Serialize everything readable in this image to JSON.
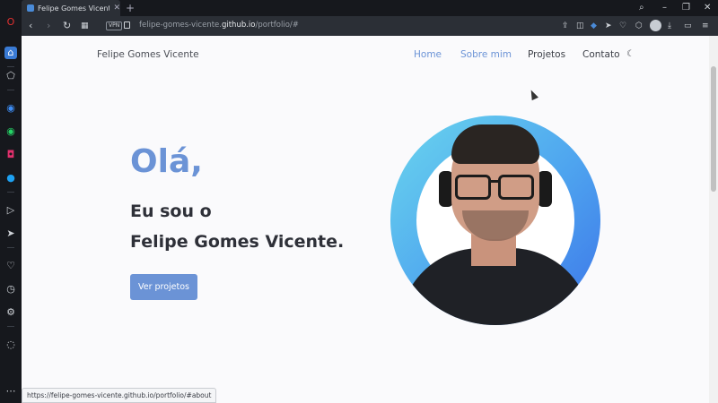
{
  "browser": {
    "tab_title": "Felipe Gomes Vicente - Portfolio",
    "tab_close": "✕",
    "new_tab": "+",
    "vpn_label": "VPN",
    "url_prefix": "felipe-gomes-vicente.",
    "url_host": "github.io",
    "url_path": "/portfolio/#",
    "status_url": "https://felipe-gomes-vicente.github.io/portfolio/#about"
  },
  "site": {
    "brand": "Felipe Gomes Vicente",
    "nav": {
      "home": "Home",
      "about": "Sobre mim",
      "projects": "Projetos",
      "contact": "Contato"
    },
    "hero": {
      "greeting": "Olá,",
      "line1": "Eu sou o",
      "line2": "Felipe Gomes Vicente.",
      "cta": "Ver projetos"
    }
  },
  "colors": {
    "accent": "#6b93d6",
    "ring_start": "#6ad6ee",
    "ring_end": "#3c74e8",
    "text_dark": "#2e3038"
  },
  "icons": {
    "theme_toggle": "moon-icon"
  }
}
